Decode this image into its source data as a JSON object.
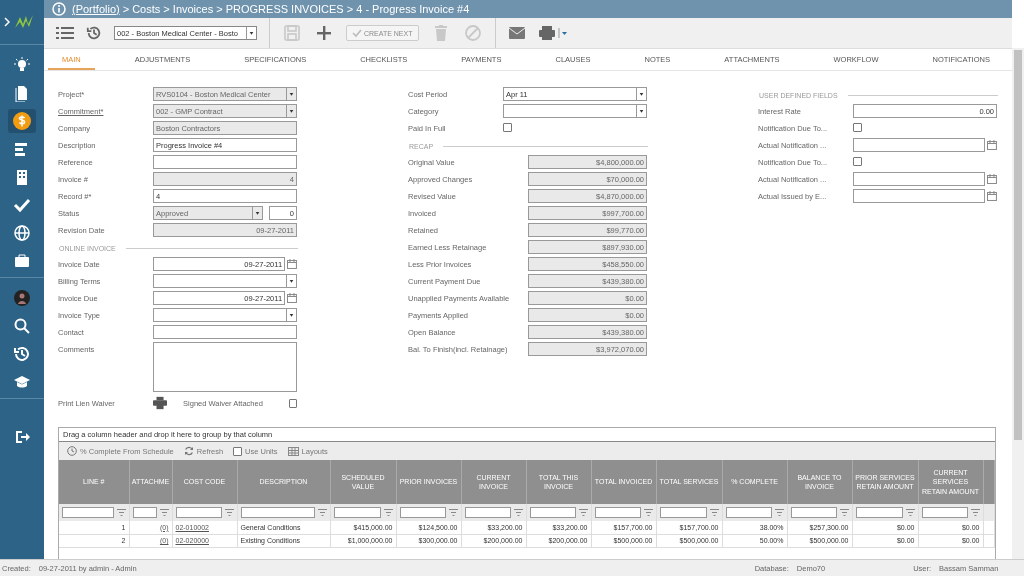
{
  "sidebar": {
    "groups": [
      [
        {
          "kind": "bulb",
          "selected": false
        },
        {
          "kind": "document",
          "selected": false
        },
        {
          "kind": "dollar",
          "selected": true
        },
        {
          "kind": "bars",
          "selected": false
        },
        {
          "kind": "building",
          "selected": false
        },
        {
          "kind": "check",
          "selected": false
        },
        {
          "kind": "globe",
          "selected": false
        },
        {
          "kind": "briefcase",
          "selected": false
        }
      ],
      [
        {
          "kind": "avatar",
          "selected": false
        },
        {
          "kind": "search",
          "selected": false
        },
        {
          "kind": "history",
          "selected": false
        },
        {
          "kind": "cap",
          "selected": false
        }
      ],
      [
        {
          "kind": "exit",
          "selected": false
        }
      ]
    ]
  },
  "breadcrumb": {
    "link": "(Portfolio)",
    "path": "> Costs > Invoices > PROGRESS INVOICES > 4 - Progress Invoice #4"
  },
  "toolbar": {
    "record_select": {
      "value": "002 - Boston Medical Center - Bosto"
    },
    "actions": [
      {
        "kind": "save",
        "disabled": true
      },
      {
        "kind": "add",
        "disabled": false
      },
      {
        "kind": "create-next",
        "label": "CREATE NEXT",
        "disabled": true
      },
      {
        "kind": "delete",
        "disabled": true
      },
      {
        "kind": "cancel",
        "disabled": true
      }
    ]
  },
  "tabs": [
    {
      "label": "MAIN",
      "selected": true
    },
    {
      "label": "ADJUSTMENTS",
      "selected": false
    },
    {
      "label": "SPECIFICATIONS",
      "selected": false
    },
    {
      "label": "CHECKLISTS",
      "selected": false
    },
    {
      "label": "PAYMENTS",
      "selected": false
    },
    {
      "label": "CLAUSES",
      "selected": false
    },
    {
      "label": "NOTES",
      "selected": false
    },
    {
      "label": "ATTACHMENTS",
      "selected": false
    },
    {
      "label": "WORKFLOW",
      "selected": false
    },
    {
      "label": "NOTIFICATIONS",
      "selected": false
    }
  ],
  "form": {
    "left": [
      {
        "kind": "select",
        "label": "Project*",
        "value": "RVS0104 - Boston Medical Center",
        "readonly": true
      },
      {
        "kind": "select",
        "label": "Commitment*",
        "value": "002 - GMP Contract",
        "readonly": true,
        "link": true
      },
      {
        "kind": "text",
        "label": "Company",
        "value": "Boston Contractors",
        "readonly": true
      },
      {
        "kind": "text",
        "label": "Description",
        "value": "Progress Invoice #4",
        "readonly": false
      },
      {
        "kind": "text",
        "label": "Reference",
        "readonly": false
      },
      {
        "kind": "number",
        "label": "Invoice #",
        "value": "4",
        "readonly": true
      },
      {
        "kind": "text",
        "label": "Record #*",
        "value": "4",
        "readonly": false
      },
      {
        "kind": "status",
        "label": "Status",
        "value": "Approved",
        "number": "0",
        "readonly": true
      },
      {
        "kind": "number",
        "label": "Revision Date",
        "value": "09-27-2011",
        "readonly": true
      },
      {
        "kind": "section",
        "label": "ONLINE INVOICE"
      },
      {
        "kind": "date",
        "label": "Invoice Date",
        "value": "09-27-2011",
        "readonly": false
      },
      {
        "kind": "select",
        "label": "Billing Terms",
        "readonly": false
      },
      {
        "kind": "date",
        "label": "Invoice Due",
        "value": "09-27-2011",
        "readonly": false
      },
      {
        "kind": "select",
        "label": "Invoice Type",
        "readonly": false
      },
      {
        "kind": "text",
        "label": "Contact",
        "readonly": false
      },
      {
        "kind": "textarea",
        "label": "Comments",
        "readonly": false
      },
      {
        "kind": "waiver",
        "label": "Print Lien Waiver",
        "check_label": "Signed Waiver Attached",
        "checked": false
      }
    ],
    "middle": [
      {
        "kind": "select",
        "label": "Cost Period",
        "value": "Apr 11",
        "readonly": false
      },
      {
        "kind": "select",
        "label": "Category",
        "readonly": false
      },
      {
        "kind": "checkbox",
        "label": "Paid In Full",
        "checked": false
      },
      {
        "kind": "section",
        "label": "RECAP"
      },
      {
        "kind": "money",
        "label": "Original Value",
        "value": "$4,800,000.00"
      },
      {
        "kind": "money",
        "label": "Approved Changes",
        "value": "$70,000.00"
      },
      {
        "kind": "money",
        "label": "Revised Value",
        "value": "$4,870,000.00"
      },
      {
        "kind": "money",
        "label": "Invoiced",
        "value": "$997,700.00"
      },
      {
        "kind": "money",
        "label": "Retained",
        "value": "$99,770.00"
      },
      {
        "kind": "money",
        "label": "Earned Less Retainage",
        "value": "$897,930.00"
      },
      {
        "kind": "money",
        "label": "Less Prior Invoices",
        "value": "$458,550.00"
      },
      {
        "kind": "money",
        "label": "Current Payment Due",
        "value": "$439,380.00"
      },
      {
        "kind": "money",
        "label": "Unapplied Payments Available",
        "value": "$0.00"
      },
      {
        "kind": "money",
        "label": "Payments Applied",
        "value": "$0.00"
      },
      {
        "kind": "money",
        "label": "Open Balance",
        "value": "$439,380.00"
      },
      {
        "kind": "money",
        "label": "Bal. To Finish(incl. Retainage)",
        "value": "$3,972,070.00"
      }
    ],
    "right": [
      {
        "kind": "section",
        "label": "USER DEFINED FIELDS"
      },
      {
        "kind": "number",
        "label": "Interest Rate",
        "value": "0.00",
        "readonly": false
      },
      {
        "kind": "checkbox",
        "label": "Notification Due To...",
        "checked": false
      },
      {
        "kind": "date",
        "label": "Actual Notification ...",
        "readonly": false
      },
      {
        "kind": "checkbox",
        "label": "Notification Due To...",
        "checked": false
      },
      {
        "kind": "date",
        "label": "Actual Notification ...",
        "readonly": false
      },
      {
        "kind": "date",
        "label": "Actual Issued by E...",
        "readonly": false
      }
    ]
  },
  "grid": {
    "group_hint": "Drag a column header and drop it here to group by that column",
    "tools": [
      {
        "kind": "schedule",
        "label": "% Complete From Schedule"
      },
      {
        "kind": "refresh",
        "label": "Refresh"
      },
      {
        "kind": "checkbox",
        "label": "Use Units",
        "checked": false
      },
      {
        "kind": "layouts",
        "label": "Layouts"
      }
    ],
    "columns": [
      {
        "label": "LINE #",
        "kind": "number"
      },
      {
        "label": "ATTACHME",
        "kind": "count"
      },
      {
        "label": "COST CODE",
        "kind": "link"
      },
      {
        "label": "DESCRIPTION",
        "kind": "text"
      },
      {
        "label": "SCHEDULED VALUE",
        "kind": "number"
      },
      {
        "label": "PRIOR INVOICES",
        "kind": "number"
      },
      {
        "label": "CURRENT INVOICE",
        "kind": "number"
      },
      {
        "label": "TOTAL THIS INVOICE",
        "kind": "number"
      },
      {
        "label": "TOTAL INVOICED",
        "kind": "number"
      },
      {
        "label": "TOTAL SERVICES",
        "kind": "number"
      },
      {
        "label": "% COMPLETE",
        "kind": "number"
      },
      {
        "label": "BALANCE TO INVOICE",
        "kind": "number"
      },
      {
        "label": "PRIOR SERVICES RETAIN AMOUNT",
        "kind": "number"
      },
      {
        "label": "CURRENT SERVICES RETAIN AMOUNT",
        "kind": "number"
      }
    ],
    "rows": [
      [
        "1",
        "(0)",
        "02-010002",
        "General Conditions",
        "$415,000.00",
        "$124,500.00",
        "$33,200.00",
        "$33,200.00",
        "$157,700.00",
        "$157,700.00",
        "38.00%",
        "$257,300.00",
        "$0.00",
        "$0.00"
      ],
      [
        "2",
        "(0)",
        "02-020000",
        "Existing Conditions",
        "$1,000,000.00",
        "$300,000.00",
        "$200,000.00",
        "$200,000.00",
        "$500,000.00",
        "$500,000.00",
        "50.00%",
        "$500,000.00",
        "$0.00",
        "$0.00"
      ]
    ]
  },
  "status_bar": {
    "created_label": "Created:",
    "created": "09-27-2011 by admin - Admin",
    "database_label": "Database:",
    "database": "Demo70",
    "user_label": "User:",
    "user": "Bassam Samman"
  }
}
